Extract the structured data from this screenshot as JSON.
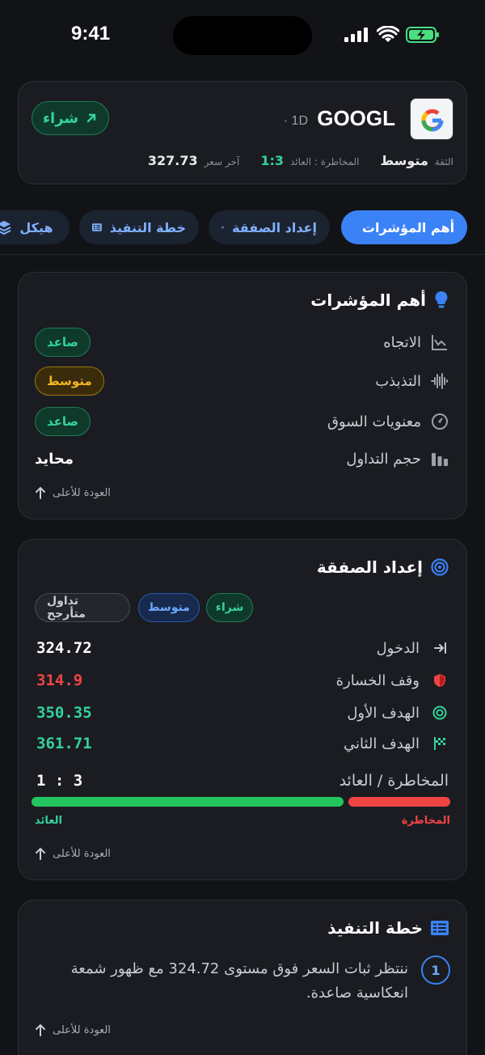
{
  "status": {
    "time": "9:41"
  },
  "header": {
    "symbol": "GOOGL",
    "timeframe": "· 1D",
    "action": "شراء",
    "confidence_label": "الثقة",
    "confidence_value": "متوسط",
    "rr_label": "المخاطرة : العائد",
    "rr_value": "1:3",
    "price_label": "آخر سعر",
    "price_value": "327.73"
  },
  "tabs": [
    {
      "label": "أهم المؤشرات",
      "icon": "lightbulb-icon",
      "active": true
    },
    {
      "label": "إعداد الصفقة",
      "icon": "target-icon"
    },
    {
      "label": "خطة التنفيذ",
      "icon": "list-icon"
    },
    {
      "label": "هيكل",
      "icon": "layers-icon"
    }
  ],
  "indicators": {
    "title": "أهم المؤشرات",
    "rows": [
      {
        "label": "الاتجاه",
        "icon": "trend-chart-icon",
        "value": "صاعد",
        "style": "up"
      },
      {
        "label": "التذبذب",
        "icon": "waveform-icon",
        "value": "متوسط",
        "style": "mid"
      },
      {
        "label": "معنويات السوق",
        "icon": "gauge-icon",
        "value": "صاعد",
        "style": "up"
      },
      {
        "label": "حجم التداول",
        "icon": "volume-bars-icon",
        "value": "محايد",
        "style": "plain"
      }
    ],
    "back": "العودة للأعلى"
  },
  "setup": {
    "title": "إعداد الصفقة",
    "tags": [
      "شراء",
      "متوسط",
      "تداول متأرجح"
    ],
    "levels": [
      {
        "label": "الدخول",
        "icon": "entry-arrow-icon",
        "value": "324.72",
        "color": "#ffffff"
      },
      {
        "label": "وقف الخسارة",
        "icon": "shield-icon",
        "value": "314.9",
        "color": "#ef4444"
      },
      {
        "label": "الهدف الأول",
        "icon": "target-icon",
        "value": "350.35",
        "color": "#34d399"
      },
      {
        "label": "الهدف الثاني",
        "icon": "checkered-flag-icon",
        "value": "361.71",
        "color": "#34d399"
      }
    ],
    "rr_label": "المخاطرة / العائد",
    "rr_value": "1 : 3",
    "risk_label": "المخاطرة",
    "reward_label": "العائد",
    "reward_fraction": 0.75,
    "back": "العودة للأعلى"
  },
  "plan": {
    "title": "خطة التنفيذ",
    "steps": [
      {
        "num": "1",
        "text": "ننتظر ثبات السعر فوق مستوى 324.72 مع ظهور شمعة انعكاسية صاعدة."
      }
    ],
    "back": "العودة للأعلى"
  },
  "colors": {
    "accent": "#3b82f6",
    "up": "#34d399",
    "risk": "#ef4444",
    "mid": "#f5b524"
  }
}
